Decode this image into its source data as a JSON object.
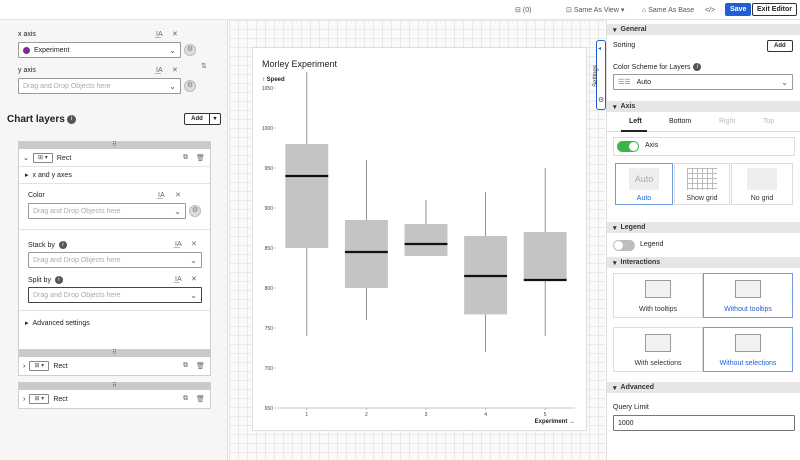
{
  "topbar": {
    "count": "(0)",
    "same_as_view": "Same As View",
    "same_as_base": "Same As Base",
    "code": "</>",
    "save": "Save",
    "exit": "Exit Editor"
  },
  "left": {
    "x_axis_label": "x axis",
    "x_axis_value": "Experiment",
    "y_axis_label": "y axis",
    "y_axis_placeholder": "Drag and Drop Objects here",
    "chart_layers_title": "Chart layers",
    "add_label": "Add",
    "layer1": {
      "name": "Rect",
      "xy_label": "x and y axes",
      "color_label": "Color",
      "color_placeholder": "Drag and Drop Objects here",
      "stack_label": "Stack by",
      "stack_placeholder": "Drag and Drop Objects here",
      "split_label": "Split by",
      "split_placeholder": "Drag and Drop Objects here",
      "advanced": "Advanced settings"
    },
    "layer2_name": "Rect",
    "layer3_name": "Rect"
  },
  "chart_data": {
    "type": "boxplot",
    "title": "Morley Experiment",
    "ylabel": "Speed",
    "xlabel": "Experiment",
    "ylim": [
      650,
      1050
    ],
    "yticks": [
      650,
      700,
      750,
      800,
      850,
      900,
      950,
      1000,
      1050
    ],
    "categories": [
      "1",
      "2",
      "3",
      "4",
      "5"
    ],
    "boxes": [
      {
        "x": "1",
        "min": 740,
        "q1": 850,
        "median": 940,
        "q3": 980,
        "max": 1070
      },
      {
        "x": "2",
        "min": 760,
        "q1": 800,
        "median": 845,
        "q3": 885,
        "max": 960
      },
      {
        "x": "3",
        "min": 840,
        "q1": 840,
        "median": 855,
        "q3": 880,
        "max": 910
      },
      {
        "x": "4",
        "min": 720,
        "q1": 767,
        "median": 815,
        "q3": 865,
        "max": 920
      },
      {
        "x": "5",
        "min": 740,
        "q1": 810,
        "median": 810,
        "q3": 870,
        "max": 950
      }
    ],
    "grid": false,
    "box_color": "#c4c4c4",
    "median_color": "#111111"
  },
  "right": {
    "settings_tab": "Settings",
    "general": "General",
    "sorting": "Sorting",
    "sorting_add": "Add",
    "color_scheme_label": "Color Scheme for Layers",
    "color_scheme_value": "Auto",
    "axis": "Axis",
    "tabs": [
      "Left",
      "Bottom",
      "Right",
      "Top"
    ],
    "axis_toggle": "Axis",
    "axis_options": [
      "Auto",
      "Show grid",
      "No grid"
    ],
    "auto_thumb": "Auto",
    "legend_section": "Legend",
    "legend_toggle": "Legend",
    "interactions": "Interactions",
    "interaction_options": [
      "With tooltips",
      "Without tooltips",
      "With selections",
      "Without selections"
    ],
    "advanced": "Advanced",
    "query_limit_label": "Query Limit",
    "query_limit_value": "1000"
  },
  "colors": {
    "accent": "#1f5fd6",
    "toggle_on": "#3ab54a"
  }
}
